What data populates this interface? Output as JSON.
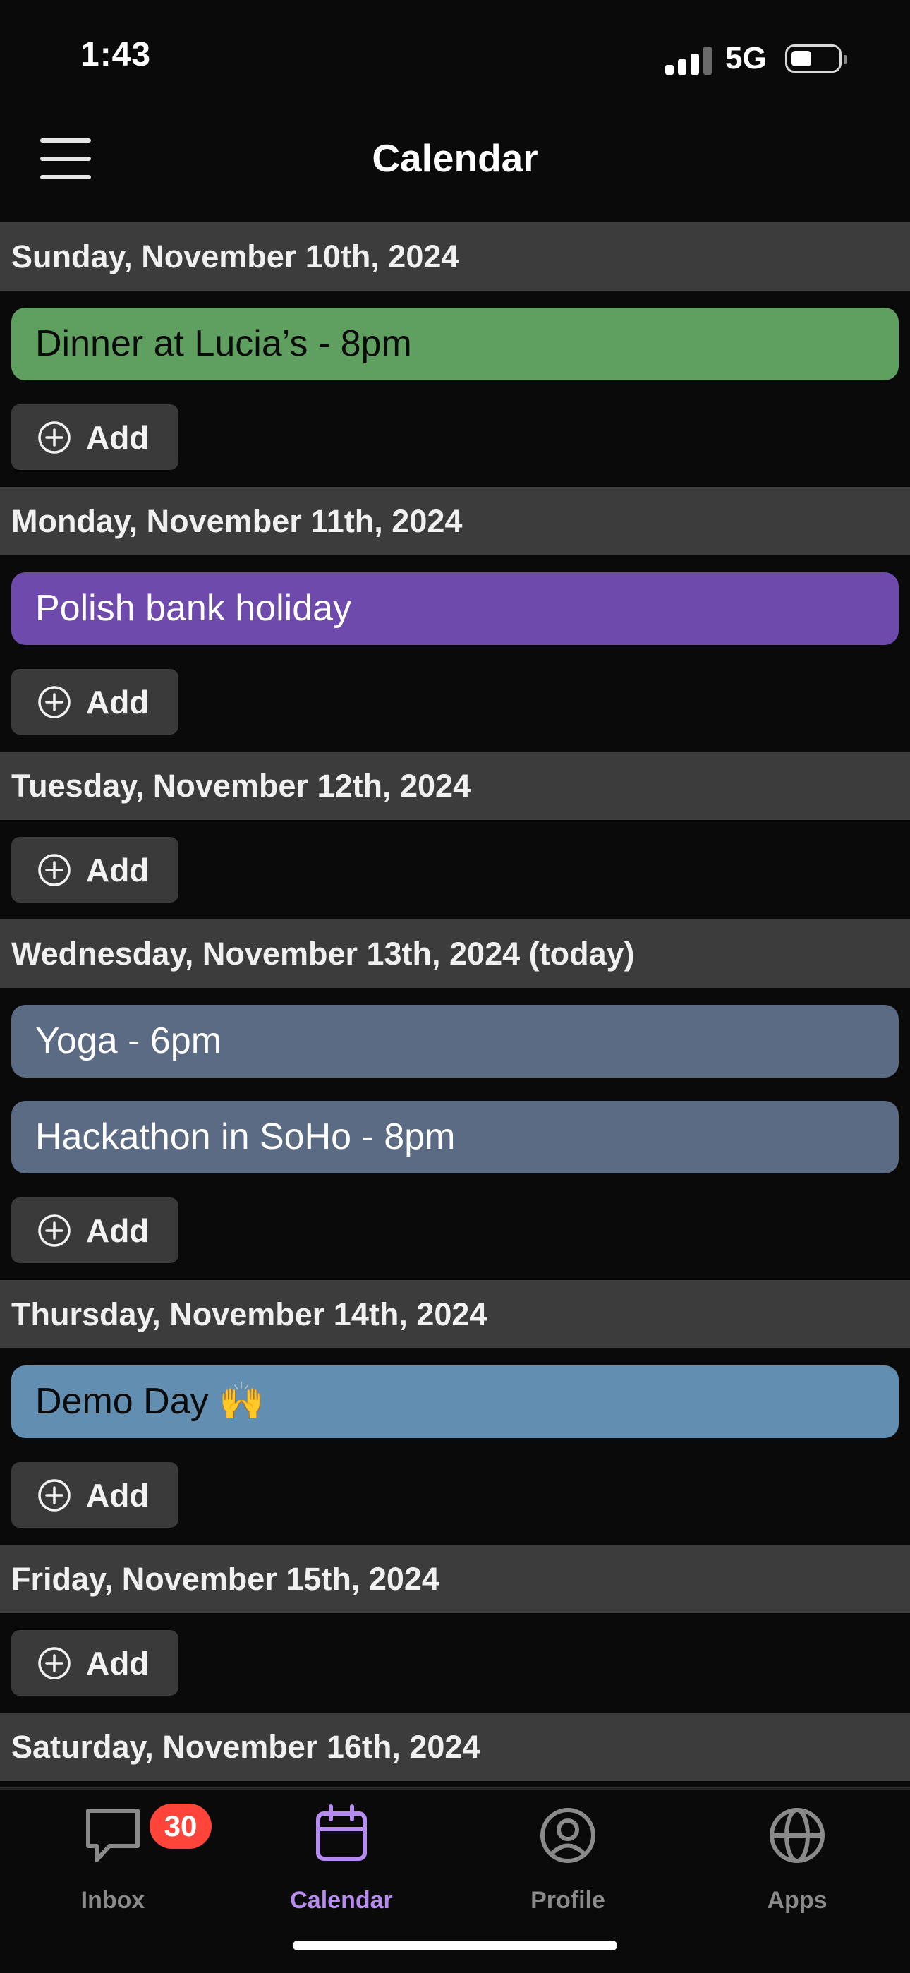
{
  "status_bar": {
    "time": "1:43",
    "network": "5G"
  },
  "header": {
    "title": "Calendar"
  },
  "add_label": "Add",
  "days": [
    {
      "label": "Sunday, November 10th, 2024",
      "events": [
        {
          "title": "Dinner at Lucia’s - 8pm",
          "color": "#5fa060",
          "text_color": "#0b0b0b"
        }
      ]
    },
    {
      "label": "Monday, November 11th, 2024",
      "events": [
        {
          "title": "Polish bank holiday",
          "color": "#6e4aad",
          "text_color": "#ffffff"
        }
      ]
    },
    {
      "label": "Tuesday, November 12th, 2024",
      "events": []
    },
    {
      "label": "Wednesday, November 13th, 2024 (today)",
      "events": [
        {
          "title": "Yoga - 6pm",
          "color": "#5a6b83",
          "text_color": "#ffffff"
        },
        {
          "title": "Hackathon in SoHo - 8pm",
          "color": "#5a6b83",
          "text_color": "#ffffff"
        }
      ]
    },
    {
      "label": "Thursday, November 14th, 2024",
      "events": [
        {
          "title": "Demo Day 🙌",
          "color": "#628eb2",
          "text_color": "#0b0b0b"
        }
      ]
    },
    {
      "label": "Friday, November 15th, 2024",
      "events": []
    },
    {
      "label": "Saturday, November 16th, 2024",
      "events": []
    }
  ],
  "tabs": [
    {
      "id": "inbox",
      "label": "Inbox",
      "icon": "chat-bubble-icon",
      "badge": "30",
      "active": false
    },
    {
      "id": "calendar",
      "label": "Calendar",
      "icon": "calendar-icon",
      "active": true
    },
    {
      "id": "profile",
      "label": "Profile",
      "icon": "person-circle-icon",
      "active": false
    },
    {
      "id": "apps",
      "label": "Apps",
      "icon": "globe-icon",
      "active": false
    }
  ],
  "colors": {
    "accent": "#b68cf0",
    "tab_inactive": "#8a8a8a",
    "day_header_bg": "#3c3c3c",
    "add_button_bg": "#3a3a3a",
    "badge": "#ff453a"
  }
}
